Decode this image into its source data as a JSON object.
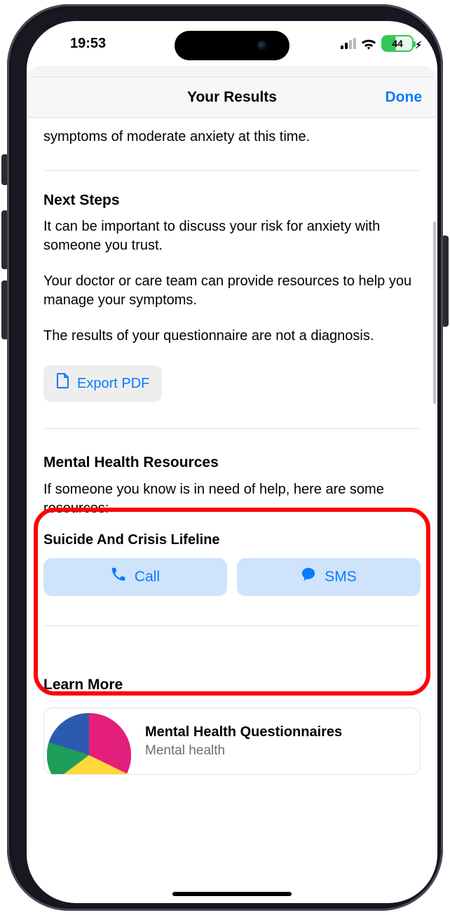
{
  "status": {
    "time": "19:53",
    "battery_pct": "44"
  },
  "header": {
    "title": "Your Results",
    "done": "Done"
  },
  "intro_line": "symptoms of moderate anxiety at this time.",
  "next_steps": {
    "title": "Next Steps",
    "p1": "It can be important to discuss your risk for anxiety with someone you trust.",
    "p2": "Your doctor or care team can provide resources to help you manage your symptoms.",
    "p3": "The results of your questionnaire are not a diagnosis.",
    "export_label": "Export PDF"
  },
  "resources": {
    "title": "Mental Health Resources",
    "intro": "If someone you know is in need of help, here are some resources:",
    "lifeline_title": "Suicide And Crisis Lifeline",
    "call_label": "Call",
    "sms_label": "SMS"
  },
  "learn_more": {
    "title": "Learn More",
    "card_title": "Mental Health Questionnaires",
    "card_sub": "Mental health"
  },
  "colors": {
    "ios_blue": "#0a7aff",
    "callout_red": "#fb0007",
    "soft_blue_bg": "#cfe3fb",
    "battery_green": "#34c759"
  }
}
